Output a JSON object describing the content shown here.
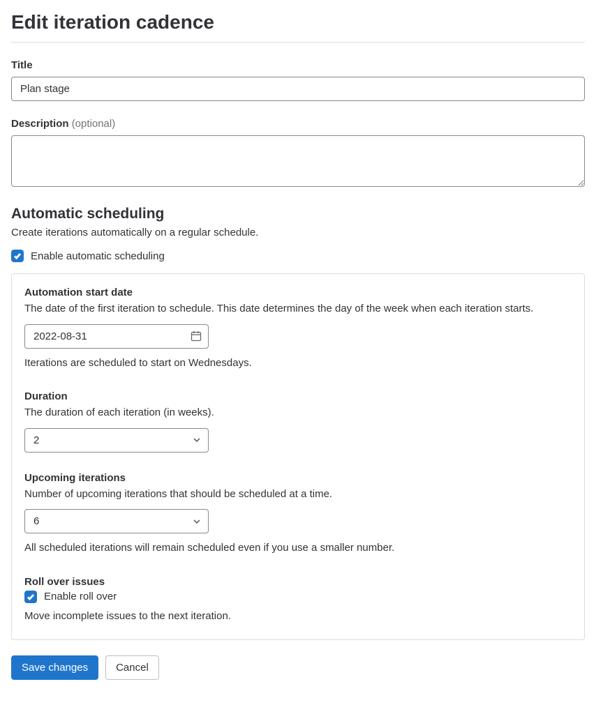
{
  "page": {
    "title": "Edit iteration cadence"
  },
  "title_field": {
    "label": "Title",
    "value": "Plan stage"
  },
  "description_field": {
    "label": "Description",
    "optional": "(optional)",
    "value": ""
  },
  "scheduling": {
    "heading": "Automatic scheduling",
    "description": "Create iterations automatically on a regular schedule.",
    "enable_label": "Enable automatic scheduling",
    "enabled": true
  },
  "start_date": {
    "label": "Automation start date",
    "help": "The date of the first iteration to schedule. This date determines the day of the week when each iteration starts.",
    "value": "2022-08-31",
    "below": "Iterations are scheduled to start on Wednesdays."
  },
  "duration": {
    "label": "Duration",
    "help": "The duration of each iteration (in weeks).",
    "value": "2"
  },
  "upcoming": {
    "label": "Upcoming iterations",
    "help": "Number of upcoming iterations that should be scheduled at a time.",
    "value": "6",
    "below": "All scheduled iterations will remain scheduled even if you use a smaller number."
  },
  "rollover": {
    "label": "Roll over issues",
    "enable_label": "Enable roll over",
    "enabled": true,
    "help": "Move incomplete issues to the next iteration."
  },
  "actions": {
    "save": "Save changes",
    "cancel": "Cancel"
  }
}
